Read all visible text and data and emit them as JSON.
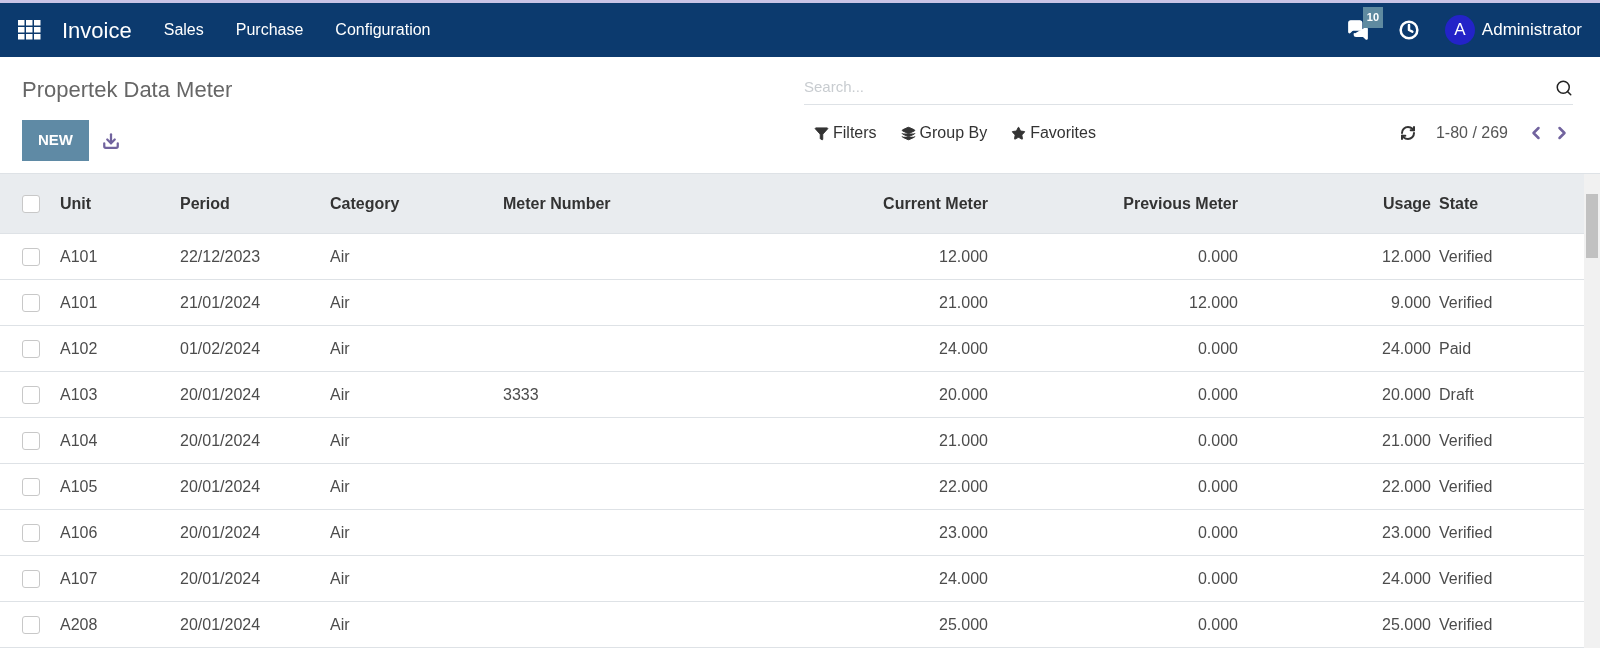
{
  "navbar": {
    "app_name": "Invoice",
    "menu": [
      "Sales",
      "Purchase",
      "Configuration"
    ],
    "messages_count": "10",
    "user_initial": "A",
    "user_name": "Administrator"
  },
  "control_panel": {
    "title": "Propertek Data Meter",
    "new_button": "NEW",
    "search": {
      "placeholder": "Search..."
    },
    "filters": [
      "Filters",
      "Group By",
      "Favorites"
    ],
    "pager": "1-80 / 269"
  },
  "table": {
    "select_all_checked": false,
    "columns": [
      "Unit",
      "Period",
      "Category",
      "Meter Number",
      "Current Meter",
      "Previous Meter",
      "Usage",
      "State"
    ],
    "rows": [
      {
        "checked": false,
        "cells": [
          "A101",
          "22/12/2023",
          "Air",
          "",
          "12.000",
          "0.000",
          "12.000",
          "Verified"
        ]
      },
      {
        "checked": false,
        "cells": [
          "A101",
          "21/01/2024",
          "Air",
          "",
          "21.000",
          "12.000",
          "9.000",
          "Verified"
        ]
      },
      {
        "checked": false,
        "cells": [
          "A102",
          "01/02/2024",
          "Air",
          "",
          "24.000",
          "0.000",
          "24.000",
          "Paid"
        ]
      },
      {
        "checked": false,
        "cells": [
          "A103",
          "20/01/2024",
          "Air",
          "3333",
          "20.000",
          "0.000",
          "20.000",
          "Draft"
        ]
      },
      {
        "checked": false,
        "cells": [
          "A104",
          "20/01/2024",
          "Air",
          "",
          "21.000",
          "0.000",
          "21.000",
          "Verified"
        ]
      },
      {
        "checked": false,
        "cells": [
          "A105",
          "20/01/2024",
          "Air",
          "",
          "22.000",
          "0.000",
          "22.000",
          "Verified"
        ]
      },
      {
        "checked": false,
        "cells": [
          "A106",
          "20/01/2024",
          "Air",
          "",
          "23.000",
          "0.000",
          "23.000",
          "Verified"
        ]
      },
      {
        "checked": false,
        "cells": [
          "A107",
          "20/01/2024",
          "Air",
          "",
          "24.000",
          "0.000",
          "24.000",
          "Verified"
        ]
      },
      {
        "checked": false,
        "cells": [
          "A208",
          "20/01/2024",
          "Air",
          "",
          "25.000",
          "0.000",
          "25.000",
          "Verified"
        ]
      }
    ]
  }
}
